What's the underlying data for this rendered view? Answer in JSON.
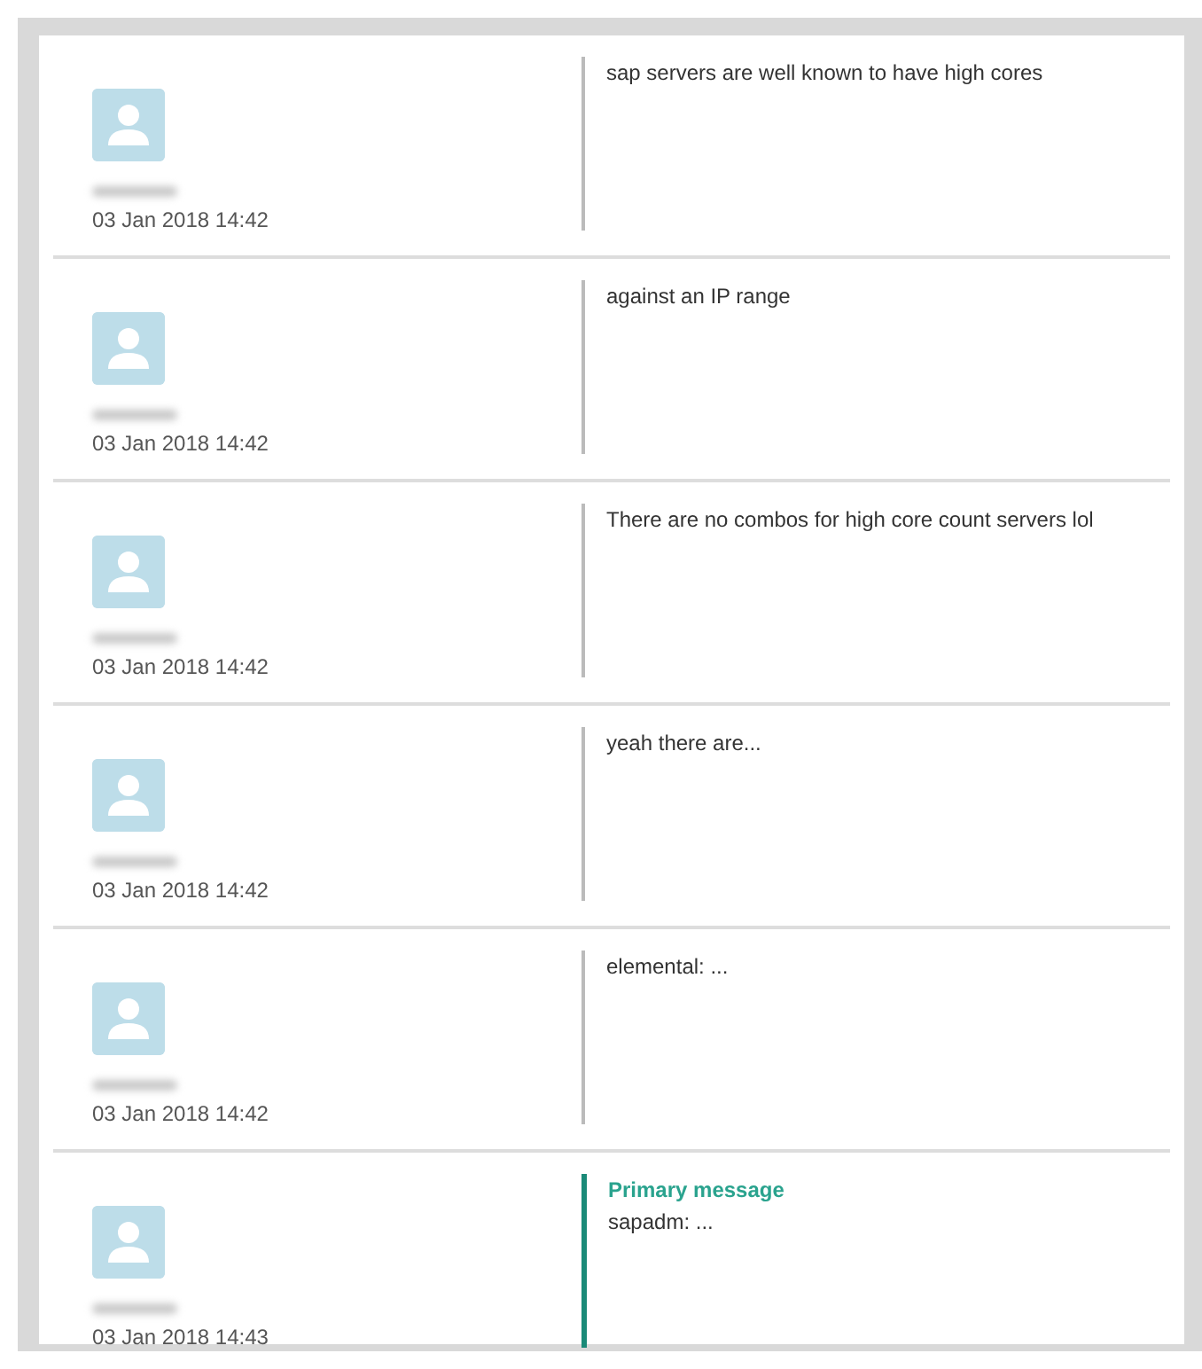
{
  "messages": [
    {
      "timestamp": "03 Jan 2018 14:42",
      "text": "sap servers are well known to have high cores",
      "primary": false
    },
    {
      "timestamp": "03 Jan 2018 14:42",
      "text": "against an IP range",
      "primary": false
    },
    {
      "timestamp": "03 Jan 2018 14:42",
      "text": "There are no combos for high core count servers lol",
      "primary": false
    },
    {
      "timestamp": "03 Jan 2018 14:42",
      "text": "yeah there are...",
      "primary": false
    },
    {
      "timestamp": "03 Jan 2018 14:42",
      "text": "elemental: ...",
      "primary": false
    },
    {
      "timestamp": "03 Jan 2018 14:43",
      "text": "sapadm: ...",
      "primary": true,
      "label": "Primary message"
    }
  ]
}
